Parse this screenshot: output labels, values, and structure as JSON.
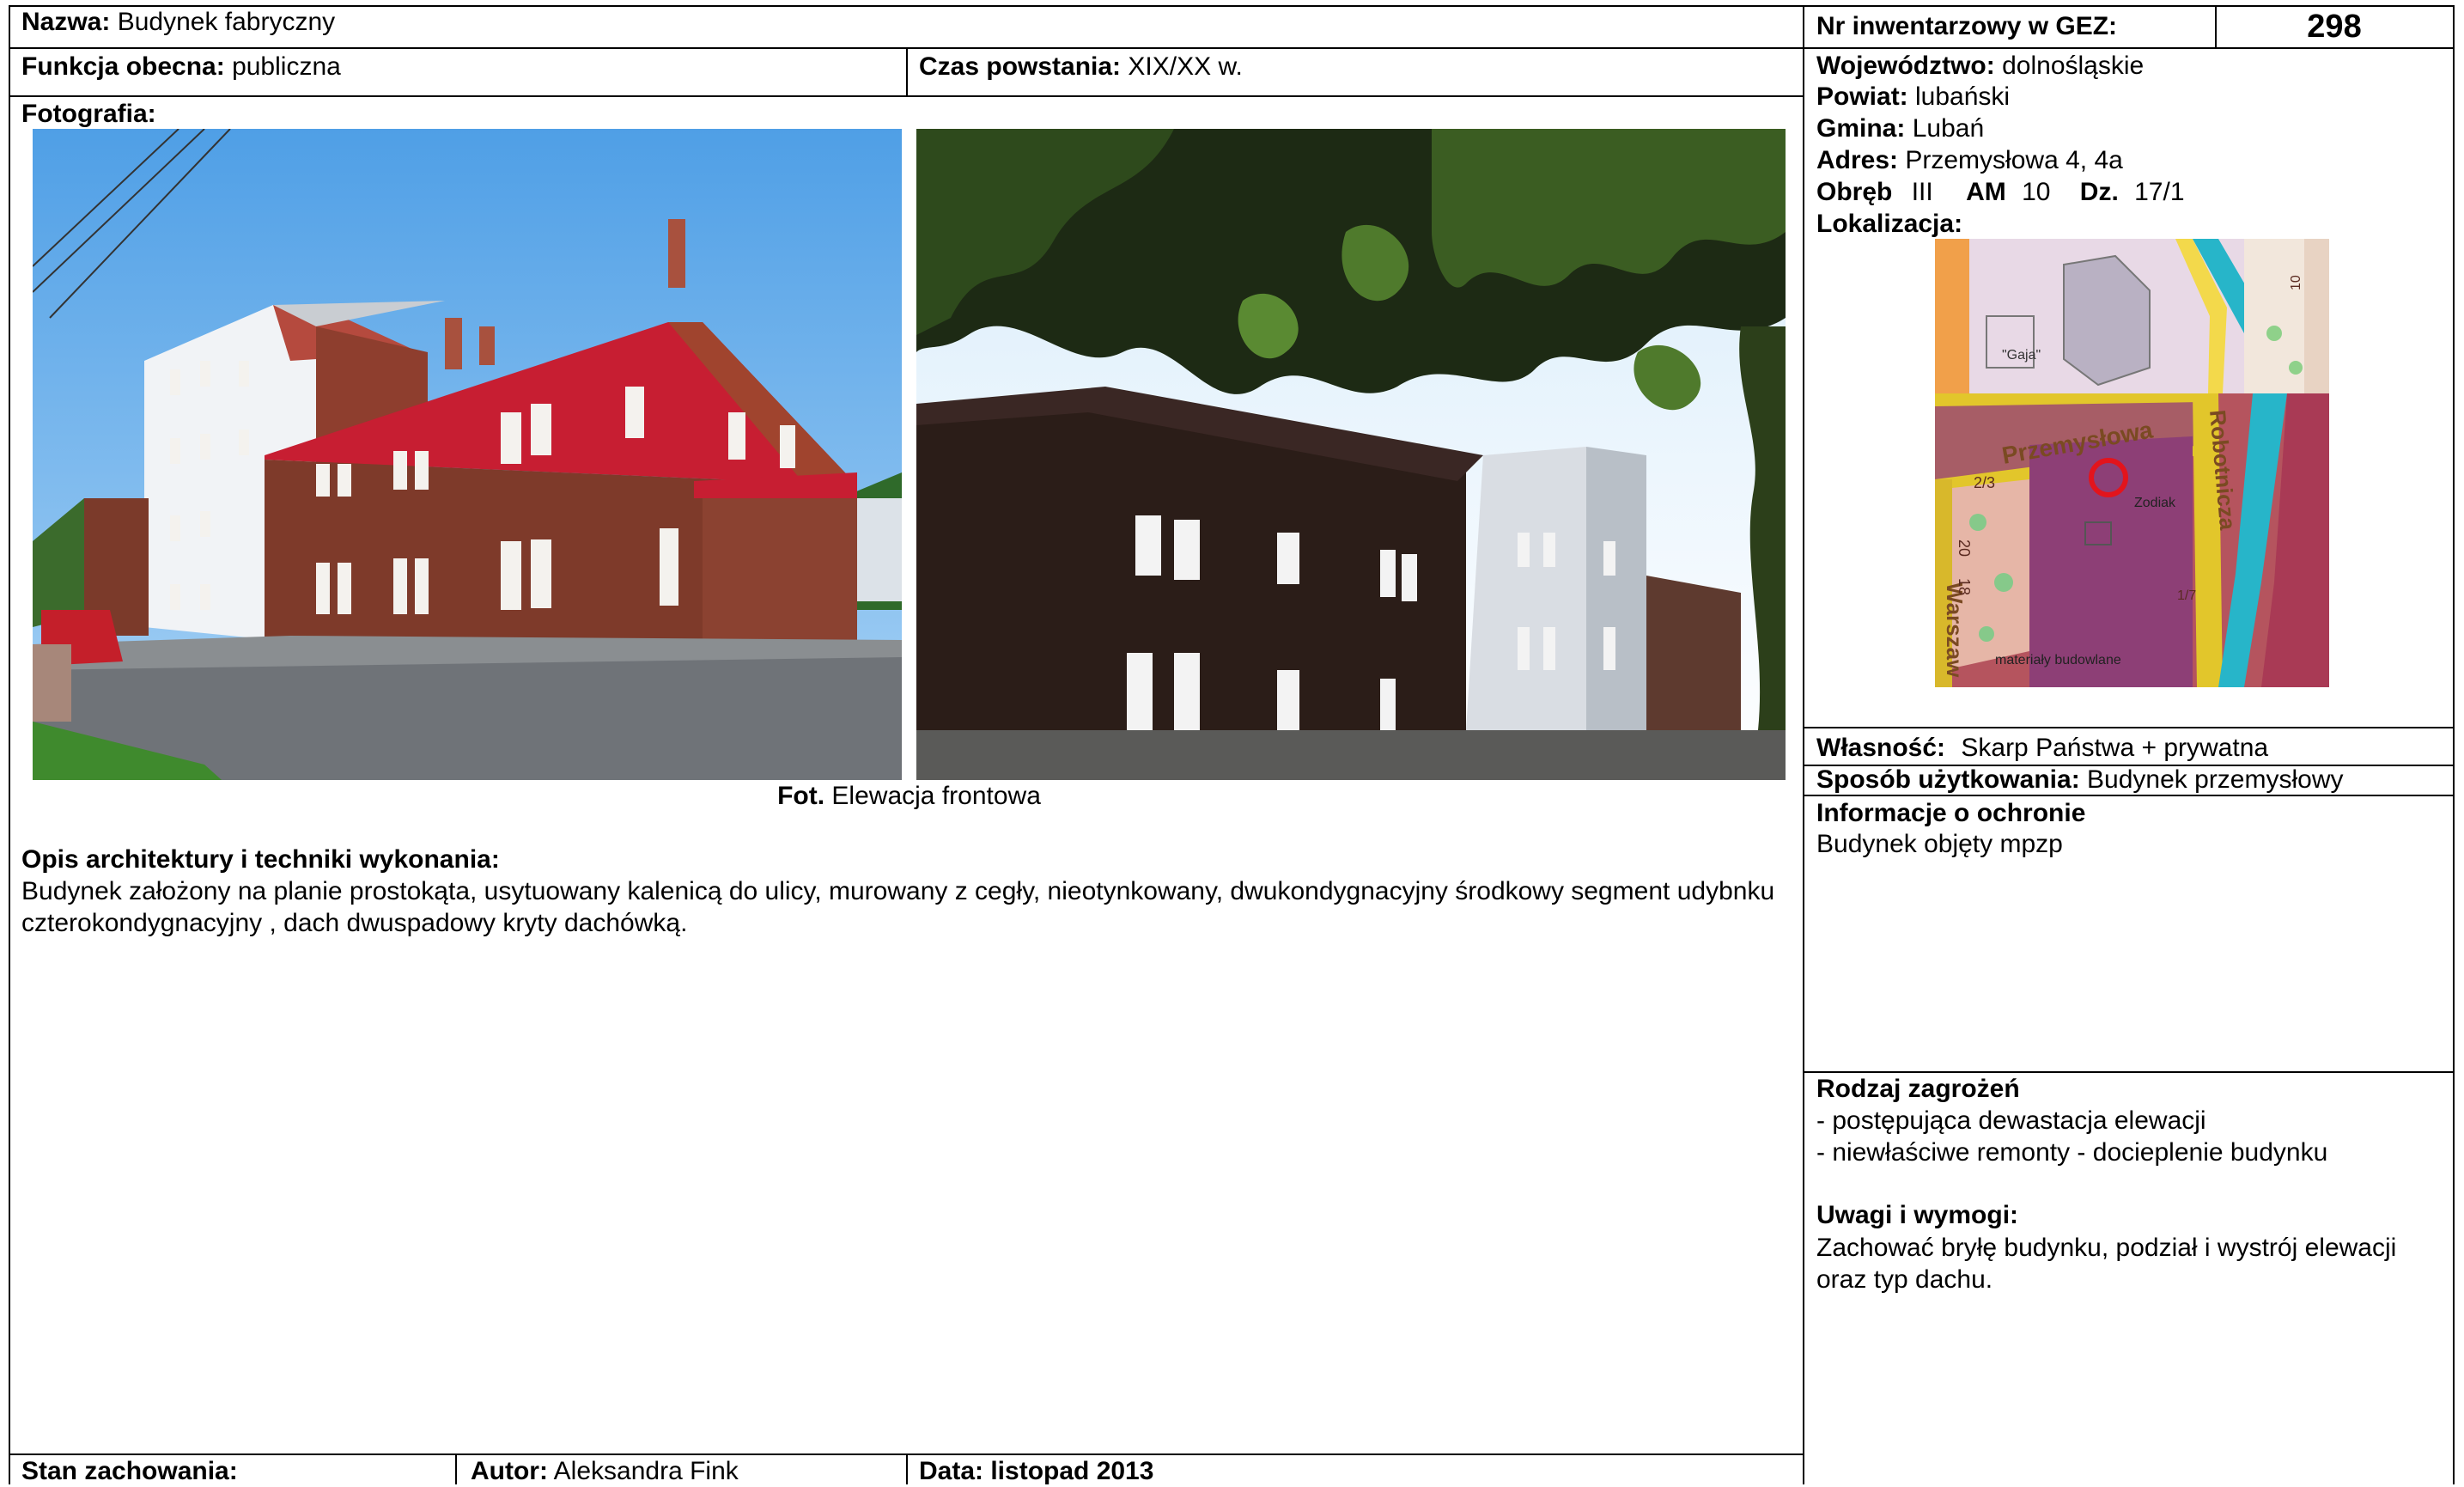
{
  "header": {
    "name_label": "Nazwa:",
    "name_value": "Budynek fabryczny",
    "inventory_label": "Nr inwentarzowy w GEZ:",
    "inventory_value": "298"
  },
  "row2": {
    "function_label": "Funkcja obecna:",
    "function_value": "publiczna",
    "date_label": "Czas powstania:",
    "date_value": "XIX/XX w."
  },
  "location": {
    "voivodeship_label": "Województwo:",
    "voivodeship_value": "dolnośląskie",
    "county_label": "Powiat:",
    "county_value": "lubański",
    "commune_label": "Gmina:",
    "commune_value": "Lubań",
    "address_label": "Adres:",
    "address_value": "Przemysłowa 4, 4a",
    "precinct_label": "Obręb",
    "precinct_value": "III",
    "am_label": "AM",
    "am_value": "10",
    "plot_label": "Dz.",
    "plot_value": "17/1",
    "localization_label": "Lokalizacja:"
  },
  "map": {
    "labels": {
      "gaja": "\"Gaja\"",
      "street1": "Przemysłowa",
      "street2": "Robotnicza",
      "street3": "Warszaw",
      "zodiak": "Zodiak",
      "materials": "materiały budowlane",
      "num_a": "2/3",
      "num_b": "20",
      "num_c": "18",
      "num_d": "10",
      "num_e": "1/7"
    }
  },
  "photos": {
    "label": "Fotografia:",
    "caption_label": "Fot.",
    "caption_value": "Elewacja frontowa"
  },
  "ownership": {
    "label": "Własność:",
    "value": "Skarp Państwa + prywatna"
  },
  "usage": {
    "label": "Sposób użytkowania:",
    "value": "Budynek przemysłowy"
  },
  "protection": {
    "title": "Informacje o ochronie",
    "value": "Budynek objęty mpzp"
  },
  "description": {
    "title": "Opis architektury i techniki wykonania:",
    "text": "Budynek założony na planie prostokąta, usytuowany kalenicą do ulicy, murowany z cegły, nieotynkowany, dwukondygnacyjny środkowy segment udybnku czterokondygnacyjny , dach dwuspadowy kryty dachówką."
  },
  "threats": {
    "title": "Rodzaj zagrożeń",
    "items": [
      "- postępująca dewastacja elewacji",
      "- niewłaściwe remonty - docieplenie budynku"
    ]
  },
  "remarks": {
    "title": "Uwagi i wymogi:",
    "text": "Zachować bryłę budynku, podział i wystrój elewacji oraz typ dachu."
  },
  "footer": {
    "condition_label": "Stan zachowania:",
    "author_label": "Autor:",
    "author_value": "Aleksandra Fink",
    "date_label": "Data: listopad 2013"
  }
}
